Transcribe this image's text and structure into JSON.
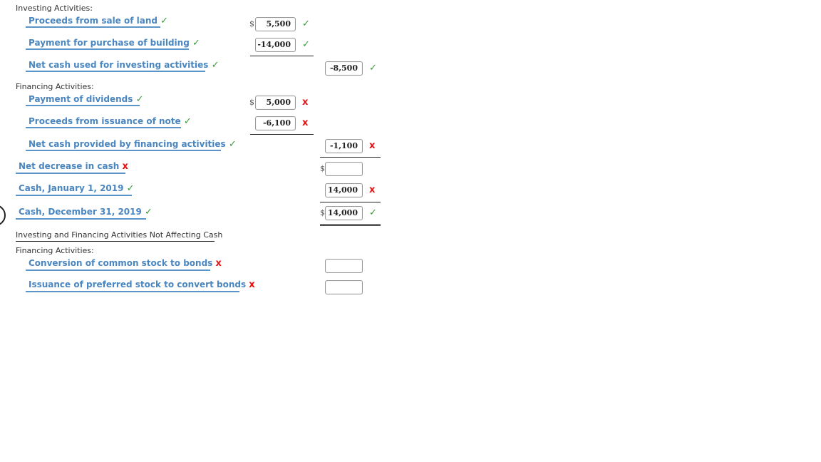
{
  "sections": {
    "investing_header": "Investing Activities:",
    "financing_header": "Financing Activities:",
    "noncash_header": "Investing and Financing Activities Not Affecting Cash",
    "noncash_financing_header": "Financing Activities:"
  },
  "rows": {
    "land": {
      "label": "Proceeds from sale of land",
      "label_mark": "check",
      "value": "5,500",
      "value_mark": "check",
      "currency": "$"
    },
    "building": {
      "label": "Payment for purchase of building",
      "label_mark": "check",
      "value": "-14,000",
      "value_mark": "check"
    },
    "net_investing": {
      "label": "Net cash used for investing activities",
      "label_mark": "check",
      "value": "-8,500",
      "value_mark": "check"
    },
    "dividends": {
      "label": "Payment of dividends",
      "label_mark": "check",
      "value": "5,000",
      "value_mark": "x",
      "currency": "$"
    },
    "note": {
      "label": "Proceeds from issuance of note",
      "label_mark": "check",
      "value": "-6,100",
      "value_mark": "x"
    },
    "net_financing": {
      "label": "Net cash provided by financing activities",
      "label_mark": "check",
      "value": "-1,100",
      "value_mark": "x"
    },
    "net_decrease": {
      "label": "Net decrease in cash",
      "label_mark": "x",
      "value": "",
      "currency": "$"
    },
    "cash_jan": {
      "label": "Cash, January 1, 2019",
      "label_mark": "check",
      "value": "14,000",
      "value_mark": "x"
    },
    "cash_dec": {
      "label": "Cash, December 31, 2019",
      "label_mark": "check",
      "value": "14,000",
      "value_mark": "check",
      "currency": "$"
    },
    "conversion": {
      "label": "Conversion of common stock to bonds",
      "label_mark": "x",
      "value": ""
    },
    "preferred": {
      "label": "Issuance of preferred stock to convert bonds",
      "label_mark": "x",
      "value": ""
    }
  },
  "marks": {
    "check": "✓",
    "x": "x"
  },
  "colors": {
    "label_blue": "#4a86c0",
    "check_green": "#3a9a3a",
    "x_red": "#e81010"
  }
}
